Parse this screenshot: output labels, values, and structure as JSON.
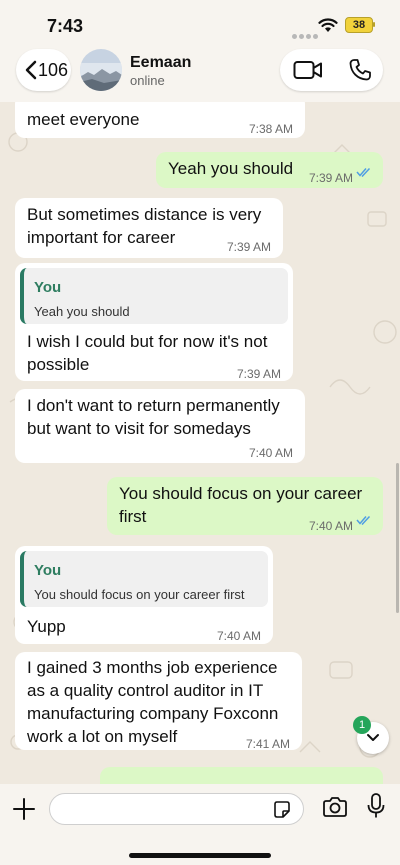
{
  "status_bar": {
    "time": "7:43",
    "battery": "38"
  },
  "header": {
    "back_count": "106",
    "contact_name": "Eemaan",
    "contact_status": "online"
  },
  "messages": [
    {
      "dir": "in",
      "text": "meet everyone",
      "time": "7:38 AM"
    },
    {
      "dir": "out",
      "text": "Yeah you should",
      "time": "7:39 AM",
      "read": true
    },
    {
      "dir": "in",
      "lines": [
        "But sometimes distance is very",
        "important for career"
      ],
      "time": "7:39 AM"
    },
    {
      "dir": "in",
      "quote_author": "You",
      "quote_text": "Yeah you should",
      "lines": [
        "I wish I could but for now it's not",
        "possible"
      ],
      "time": "7:39 AM"
    },
    {
      "dir": "in",
      "lines": [
        "I don't want to return permanently",
        "but want to visit for somedays"
      ],
      "time": "7:40 AM"
    },
    {
      "dir": "out",
      "lines": [
        "You should focus on your career",
        "first"
      ],
      "time": "7:40 AM",
      "read": true
    },
    {
      "dir": "in",
      "quote_author": "You",
      "quote_text": "You should focus on your career first",
      "text": "Yupp",
      "time": "7:40 AM"
    },
    {
      "dir": "in",
      "lines": [
        "I gained 3 months job experience",
        "as a quality control auditor in IT",
        "manufacturing company Foxconn",
        "work a lot on myself"
      ],
      "time": "7:41 AM"
    }
  ],
  "scroll_badge": "1",
  "colors": {
    "outgoing_bubble": "#dcf8c6",
    "incoming_bubble": "#ffffff",
    "read_ticks": "#4f9ee3",
    "accent_green": "#25a55a"
  },
  "icons": [
    "chevron-left-icon",
    "video-call-icon",
    "phone-icon",
    "plus-icon",
    "sticker-icon",
    "camera-icon",
    "mic-icon",
    "chevron-down-icon",
    "double-check-icon"
  ]
}
